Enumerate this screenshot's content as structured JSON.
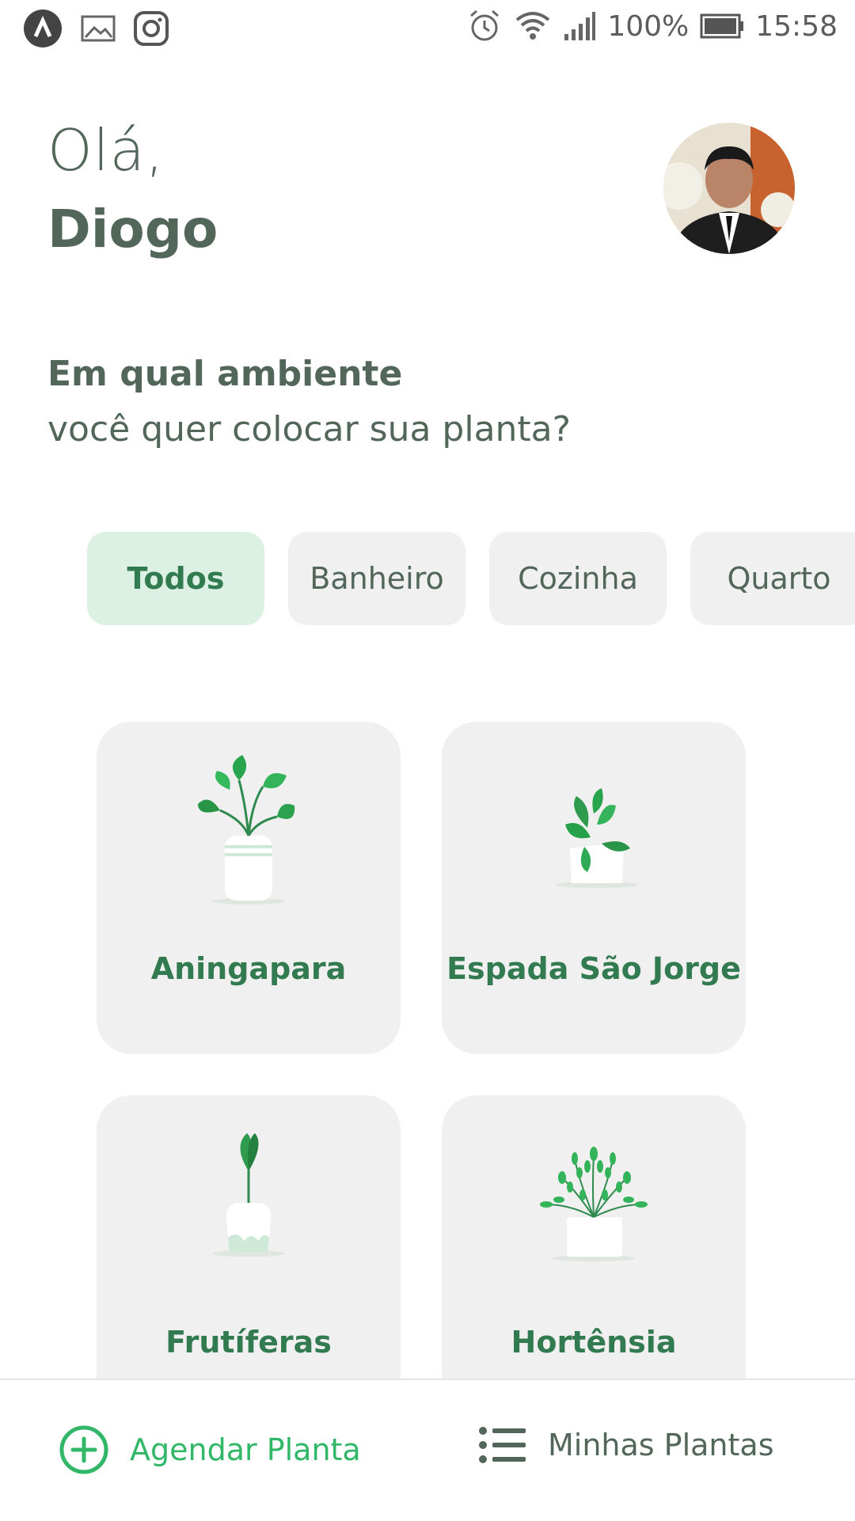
{
  "status_bar": {
    "left_icons": [
      "app-launcher-icon",
      "gallery-icon",
      "instagram-icon"
    ],
    "right_icons": [
      "alarm-icon",
      "wifi-icon",
      "signal-icon",
      "battery-icon"
    ],
    "battery": "100%",
    "time": "15:58"
  },
  "greeting": {
    "hello": "Olá,",
    "name": "Diogo"
  },
  "environment": {
    "title": "Em qual ambiente",
    "subtitle": "você quer colocar sua planta?"
  },
  "filters": [
    {
      "label": "Todos",
      "active": true
    },
    {
      "label": "Banheiro",
      "active": false
    },
    {
      "label": "Cozinha",
      "active": false
    },
    {
      "label": "Quarto",
      "active": false
    }
  ],
  "plants": [
    {
      "name": "Aningapara",
      "icon": "potted-plant-icon"
    },
    {
      "name": "Espada São Jorge",
      "icon": "potted-plant-icon"
    },
    {
      "name": "Frutíferas",
      "icon": "potted-plant-icon"
    },
    {
      "name": "Hortênsia",
      "icon": "potted-plant-icon"
    }
  ],
  "bottom_nav": {
    "schedule_label": "Agendar Planta",
    "my_plants_label": "Minhas Plantas"
  },
  "colors": {
    "green": "#32b768",
    "green_dark": "#327a4f",
    "heading": "#52665a",
    "chip_active_bg": "#dcf1e3",
    "card_bg": "#f0f0f0"
  }
}
